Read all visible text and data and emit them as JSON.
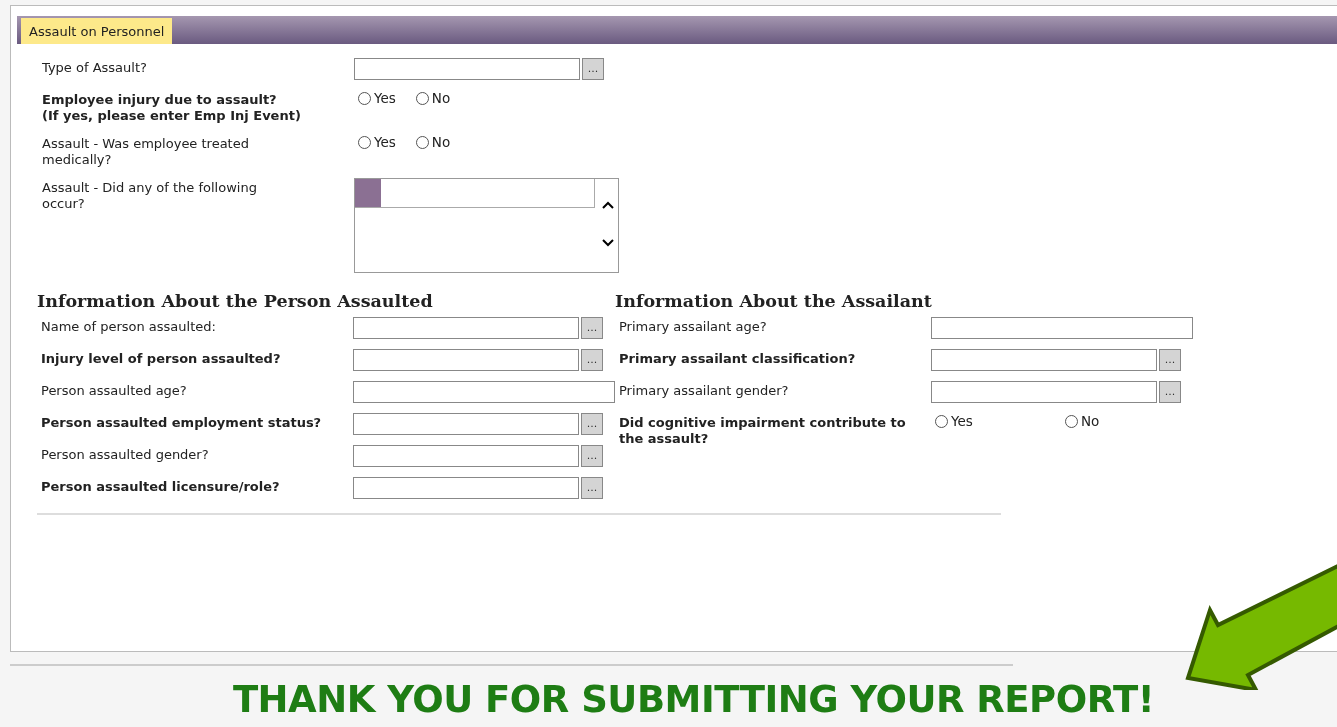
{
  "tab": {
    "label": "Assault on Personnel",
    "selected": true
  },
  "top_rows": [
    {
      "label": "Type of Assault?",
      "bold": false,
      "kind": "lookup",
      "button": "..."
    },
    {
      "label": "Employee injury due to assault?\n(If yes, please enter Emp Inj Event)",
      "bold": true,
      "kind": "radio",
      "options": [
        {
          "label": "Yes",
          "selected": false
        },
        {
          "label": "No",
          "selected": false
        }
      ]
    },
    {
      "label": "Assault - Was employee treated medically?",
      "bold": false,
      "kind": "radio",
      "options": [
        {
          "label": "Yes",
          "selected": false
        },
        {
          "label": "No",
          "selected": false
        }
      ]
    },
    {
      "label": "Assault - Did any of the following occur?",
      "bold": false,
      "kind": "listbox"
    }
  ],
  "sections": [
    {
      "title": "Information About the Person Assaulted",
      "rows": [
        {
          "label": "Name of person assaulted:",
          "bold": false,
          "kind": "lookup",
          "button": "..."
        },
        {
          "label": "Injury level of person assaulted?",
          "bold": true,
          "kind": "lookup",
          "button": "..."
        },
        {
          "label": "Person assaulted age?",
          "bold": false,
          "kind": "text"
        },
        {
          "label": "Person assaulted employment status?",
          "bold": true,
          "kind": "lookup",
          "button": "..."
        },
        {
          "label": "Person assaulted gender?",
          "bold": false,
          "kind": "lookup",
          "button": "..."
        },
        {
          "label": "Person assaulted licensure/role?",
          "bold": true,
          "kind": "lookup",
          "button": "..."
        }
      ]
    },
    {
      "title": "Information About the Assailant",
      "rows": [
        {
          "label": "Primary assailant age?",
          "bold": false,
          "kind": "text"
        },
        {
          "label": "Primary assailant classification?",
          "bold": true,
          "kind": "lookup",
          "button": "..."
        },
        {
          "label": "Primary assailant gender?",
          "bold": false,
          "kind": "lookup",
          "button": "..."
        },
        {
          "label": "Did cognitive impairment contribute to the assault?",
          "bold": true,
          "kind": "radio",
          "options": [
            {
              "label": "Yes",
              "selected": false
            },
            {
              "label": "No",
              "selected": false
            }
          ]
        }
      ]
    }
  ],
  "banner": "THANK YOU FOR SUBMITTING YOUR REPORT!"
}
